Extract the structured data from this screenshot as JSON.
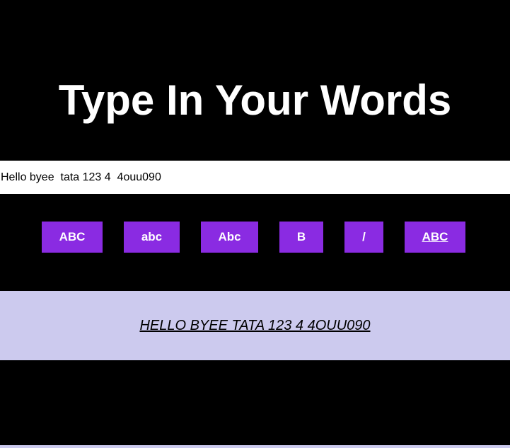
{
  "header": {
    "title": "Type In Your Words"
  },
  "input": {
    "value": "Hello byee  tata 123 4  4ouu090"
  },
  "buttons": {
    "uppercase_label": "ABC",
    "lowercase_label": "abc",
    "capitalize_label": "Abc",
    "bold_label": "B",
    "italic_label": "/",
    "underline_label": "ABC"
  },
  "output": {
    "text": "HELLO BYEE TATA 123 4 4OUU090"
  },
  "colors": {
    "background": "#000000",
    "button": "#8a2be2",
    "output_panel": "#cccaee",
    "input_background": "#ffffff"
  }
}
